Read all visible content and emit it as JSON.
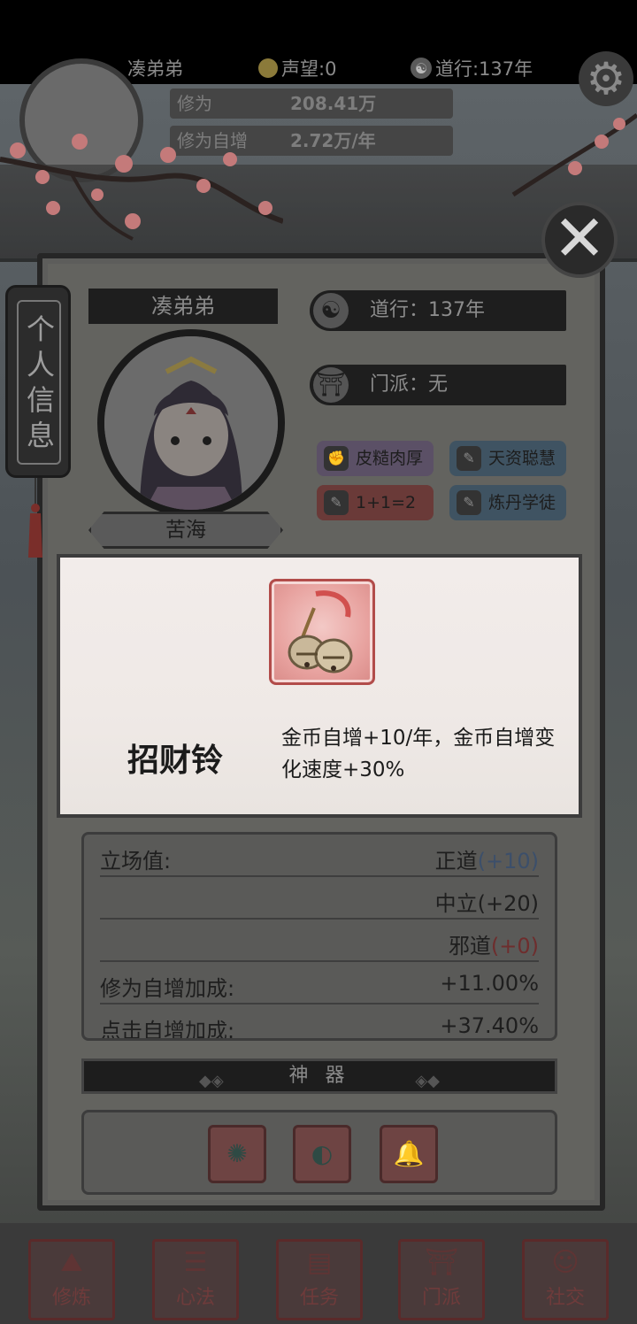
{
  "hud": {
    "player_name": "凑弟弟",
    "fame_label": "声望:0",
    "dao_label": "道行:137年",
    "cultivation_label": "修为",
    "cultivation_value": "208.41万",
    "cultivation_rate_label": "修为自增",
    "cultivation_rate_value": "2.72万/年"
  },
  "side_tab": {
    "label": "个人信息"
  },
  "profile": {
    "name": "凑弟弟",
    "title": "苦海",
    "dao": "道行：137年",
    "sect": "门派：无"
  },
  "traits": [
    {
      "label": "皮糙肉厚",
      "color": "#5b5066"
    },
    {
      "label": "天资聪慧",
      "color": "#3f5362"
    },
    {
      "label": "1+1=2",
      "color": "#6a3a38"
    },
    {
      "label": "炼丹学徒",
      "color": "#3f5362"
    }
  ],
  "tooltip": {
    "item_name": "招财铃",
    "description": "金币自增+10/年，金币自增变化速度+30%",
    "icon": "bell-icon"
  },
  "stats": {
    "stance_label": "立场值:",
    "righteous": "正道",
    "righteous_val": "(+10)",
    "neutral": "中立(+20)",
    "evil": "邪道",
    "evil_val": "(+0)",
    "cult_bonus_label": "修为自增加成:",
    "cult_bonus_val": "+11.00%",
    "next_label": "点击自增加成:",
    "next_val": "+37.40%"
  },
  "artifacts": {
    "header": "神 器",
    "slots": [
      "jade-token-icon",
      "fan-icon",
      "bell-icon"
    ]
  },
  "nav": [
    {
      "label": "修炼",
      "icon": "cultivate-icon"
    },
    {
      "label": "心法",
      "icon": "scroll-icon"
    },
    {
      "label": "任务",
      "icon": "task-icon"
    },
    {
      "label": "门派",
      "icon": "sect-icon"
    },
    {
      "label": "社交",
      "icon": "social-icon"
    }
  ],
  "colors": {
    "accent_red": "#b24c4a",
    "blue_text": "#3c4f6a",
    "red_text": "#6e2d2d"
  }
}
